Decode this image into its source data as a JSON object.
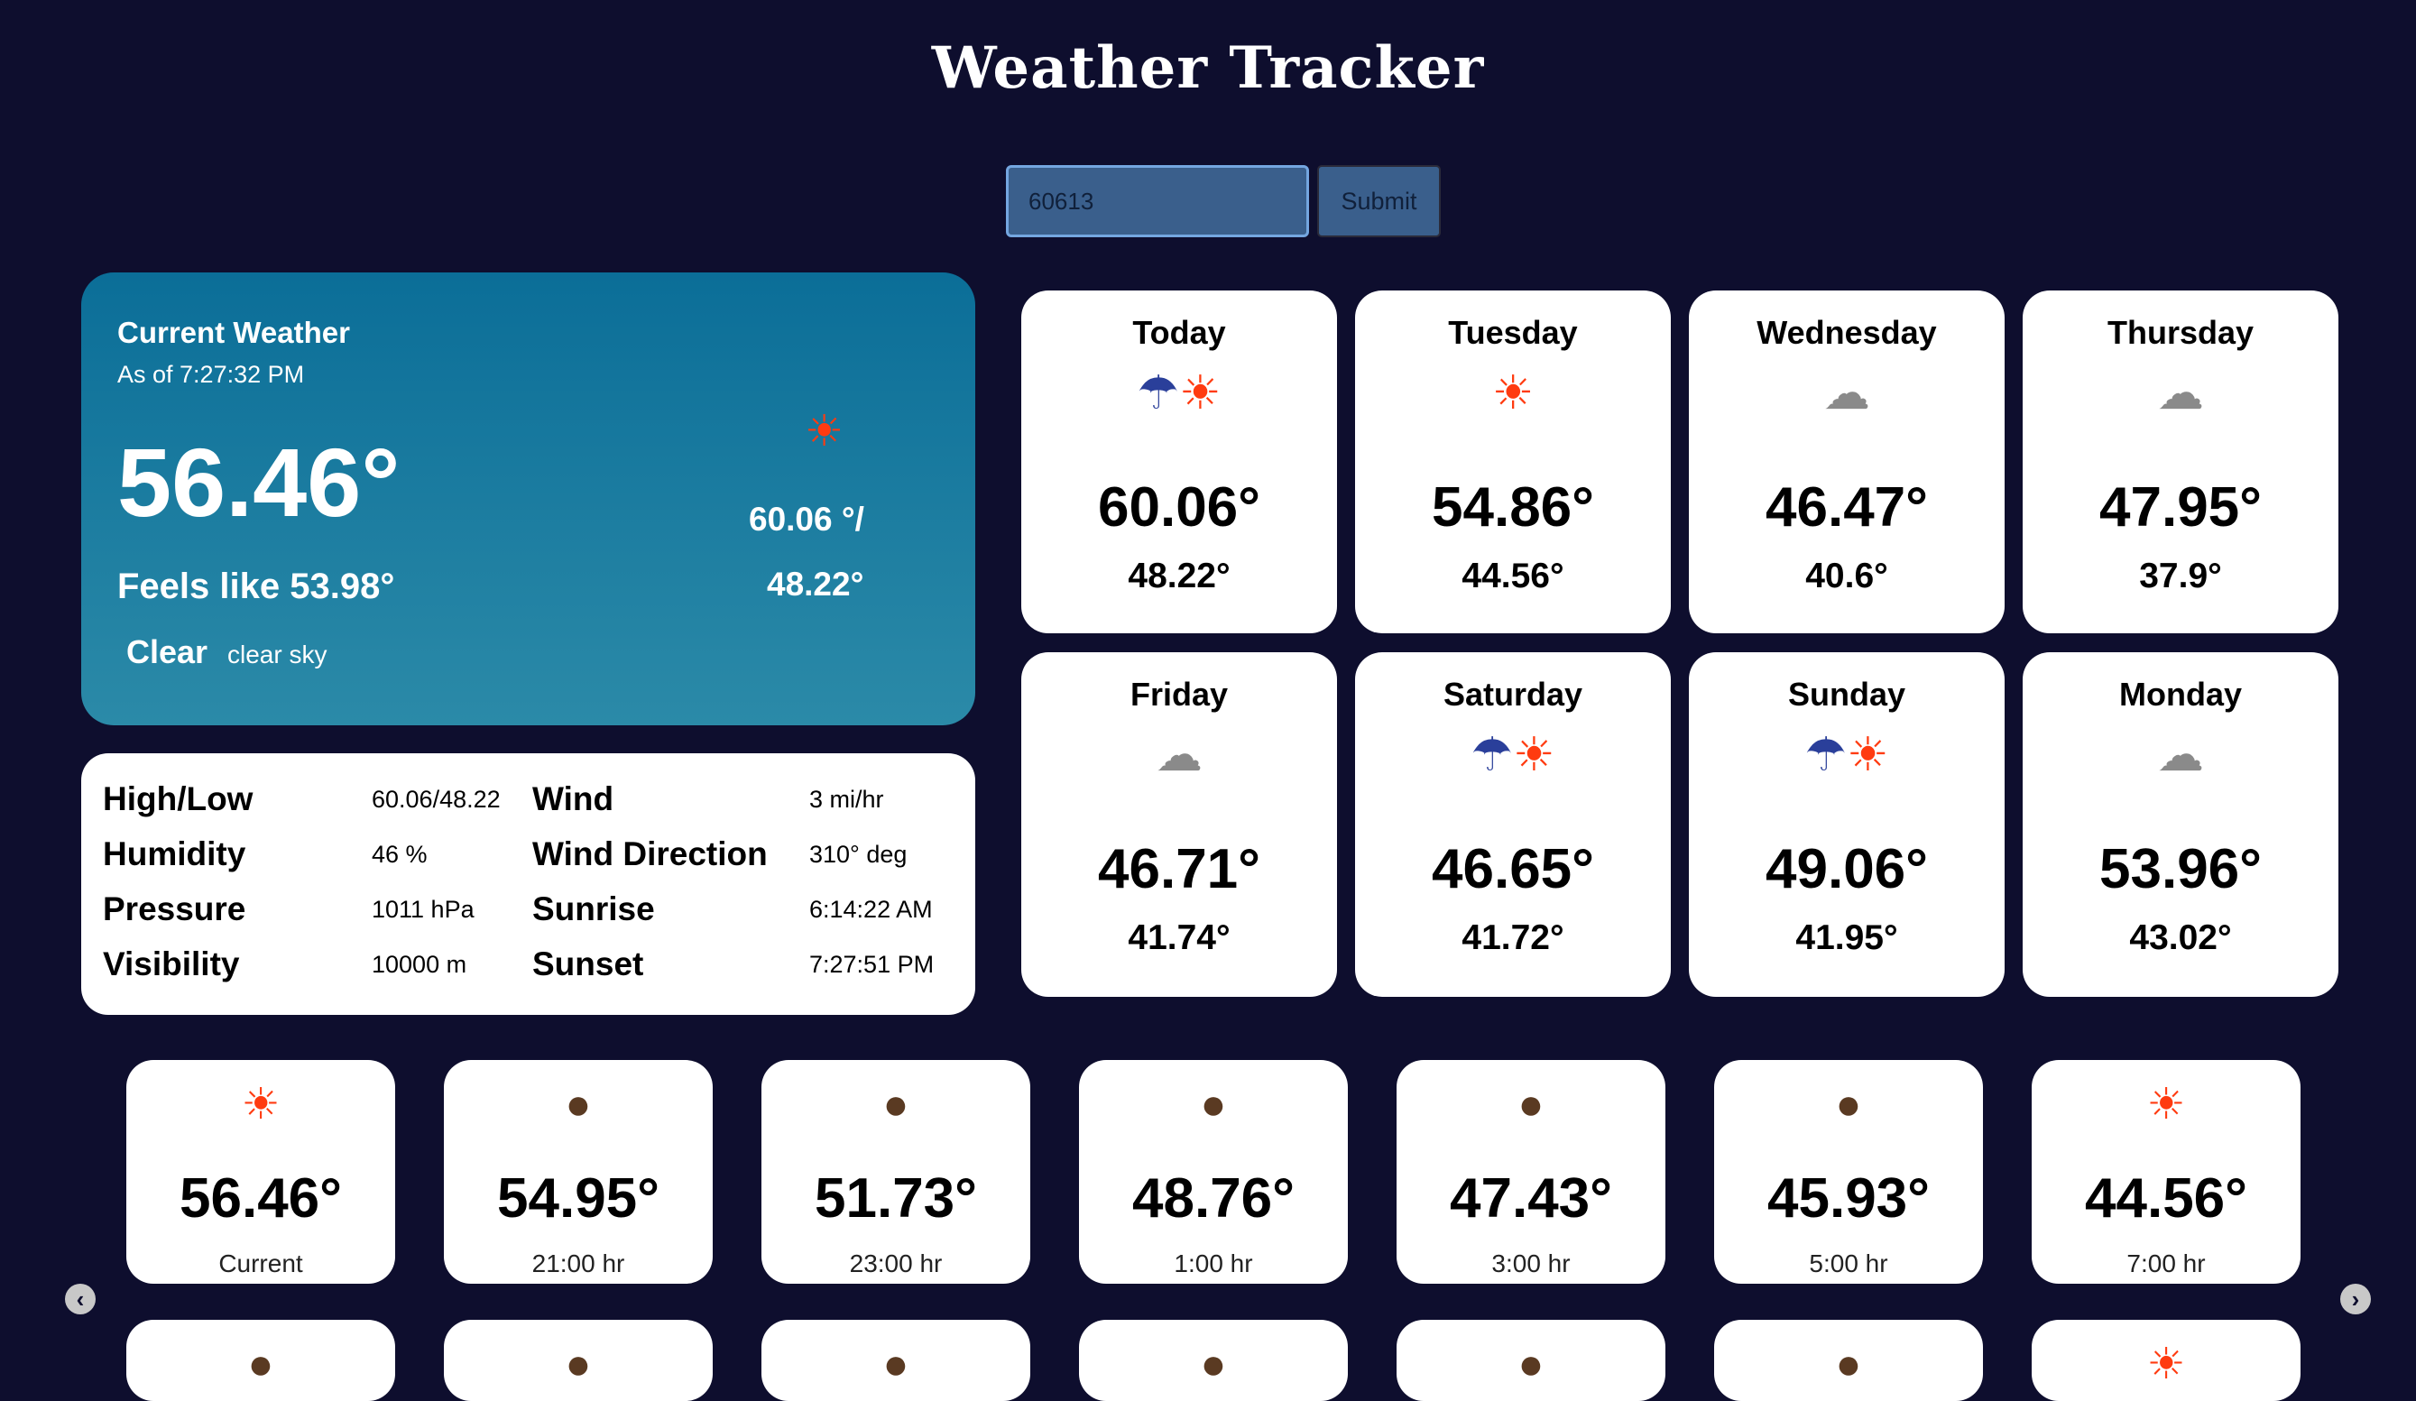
{
  "app": {
    "title": "Weather Tracker"
  },
  "search": {
    "value": "60613",
    "submit_label": "Submit"
  },
  "current": {
    "label": "Current Weather",
    "as_of": "As of 7:27:32 PM",
    "temp": "56.46°",
    "feels_like": "Feels like 53.98°",
    "main": "Clear",
    "description": "clear sky",
    "icon": "sun-icon",
    "high_low_line1": "60.06 °/",
    "high_low_line2": "48.22°"
  },
  "details": {
    "high_low_label": "High/Low",
    "high_low_value": "60.06/48.22",
    "humidity_label": "Humidity",
    "humidity_value": "46 %",
    "pressure_label": "Pressure",
    "pressure_value": "1011 hPa",
    "visibility_label": "Visibility",
    "visibility_value": "10000 m",
    "wind_label": "Wind",
    "wind_value": "3 mi/hr",
    "wind_direction_label": "Wind Direction",
    "wind_direction_value": "310° deg",
    "sunrise_label": "Sunrise",
    "sunrise_value": "6:14:22 AM",
    "sunset_label": "Sunset",
    "sunset_value": "7:27:51 PM"
  },
  "daily": [
    {
      "day": "Today",
      "hi": "60.06°",
      "lo": "48.22°",
      "icon": "rain-sun-icon"
    },
    {
      "day": "Tuesday",
      "hi": "54.86°",
      "lo": "44.56°",
      "icon": "sun-icon"
    },
    {
      "day": "Wednesday",
      "hi": "46.47°",
      "lo": "40.6°",
      "icon": "cloud-icon"
    },
    {
      "day": "Thursday",
      "hi": "47.95°",
      "lo": "37.9°",
      "icon": "cloud-icon"
    },
    {
      "day": "Friday",
      "hi": "46.71°",
      "lo": "41.74°",
      "icon": "cloud-icon"
    },
    {
      "day": "Saturday",
      "hi": "46.65°",
      "lo": "41.72°",
      "icon": "rain-sun-icon"
    },
    {
      "day": "Sunday",
      "hi": "49.06°",
      "lo": "41.95°",
      "icon": "rain-sun-icon"
    },
    {
      "day": "Monday",
      "hi": "53.96°",
      "lo": "43.02°",
      "icon": "cloud-icon"
    }
  ],
  "hourly": [
    {
      "temp": "56.46°",
      "time": "Current",
      "icon": "sun-icon"
    },
    {
      "temp": "54.95°",
      "time": "21:00 hr",
      "icon": "moon-icon"
    },
    {
      "temp": "51.73°",
      "time": "23:00 hr",
      "icon": "moon-icon"
    },
    {
      "temp": "48.76°",
      "time": "1:00 hr",
      "icon": "moon-icon"
    },
    {
      "temp": "47.43°",
      "time": "3:00 hr",
      "icon": "moon-icon"
    },
    {
      "temp": "45.93°",
      "time": "5:00 hr",
      "icon": "moon-icon"
    },
    {
      "temp": "44.56°",
      "time": "7:00 hr",
      "icon": "sun-icon"
    }
  ],
  "hourly_row2_icons": [
    "moon-icon",
    "moon-icon",
    "moon-icon",
    "moon-icon",
    "moon-icon",
    "moon-icon",
    "sun-icon"
  ],
  "nav": {
    "prev_icon": "chevron-left-icon",
    "next_icon": "chevron-right-icon",
    "prev_glyph": "‹",
    "next_glyph": "›"
  }
}
